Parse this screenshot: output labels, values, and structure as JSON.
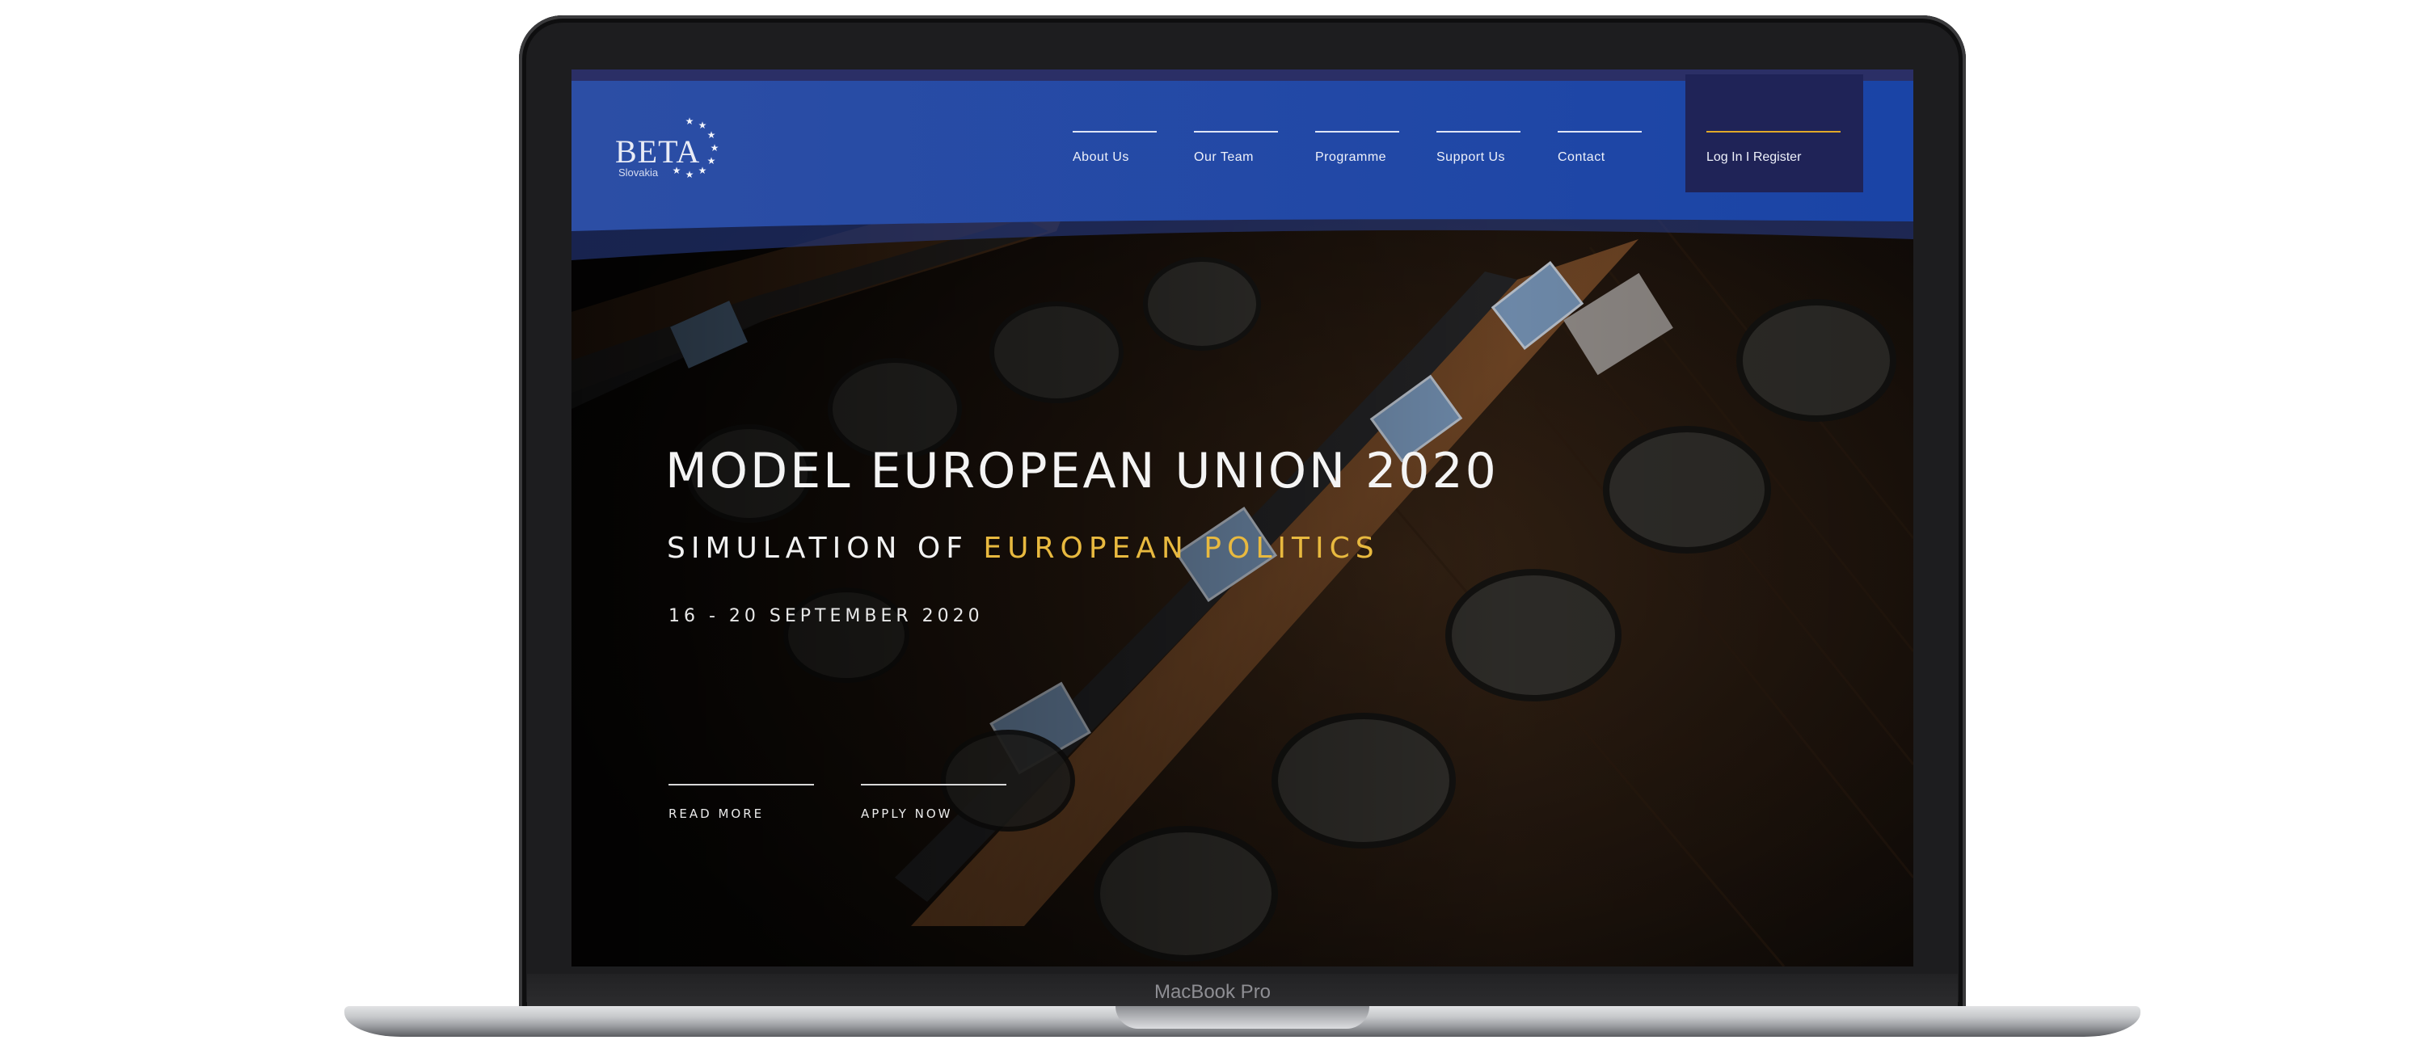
{
  "device": {
    "label": "MacBook Pro"
  },
  "site": {
    "logo": {
      "text": "BETA",
      "subtext": "Slovakia"
    },
    "nav": {
      "items": [
        {
          "label": "About Us"
        },
        {
          "label": "Our Team"
        },
        {
          "label": "Programme"
        },
        {
          "label": "Support Us"
        },
        {
          "label": "Contact"
        }
      ],
      "login_label": "Log In I Register"
    },
    "hero": {
      "title": "MODEL EUROPEAN UNION 2020",
      "subtitle_prefix": "SIMULATION OF ",
      "subtitle_accent": "EUROPEAN POLITICS",
      "date": "16 - 20 SEPTEMBER 2020",
      "buttons": [
        {
          "label": "READ MORE"
        },
        {
          "label": "APPLY NOW"
        }
      ]
    }
  },
  "colors": {
    "nav_blue": "#1f47a8",
    "login_box": "#1f2357",
    "accent_gold": "#e8b93f",
    "hero_background": "#2a1a10"
  }
}
